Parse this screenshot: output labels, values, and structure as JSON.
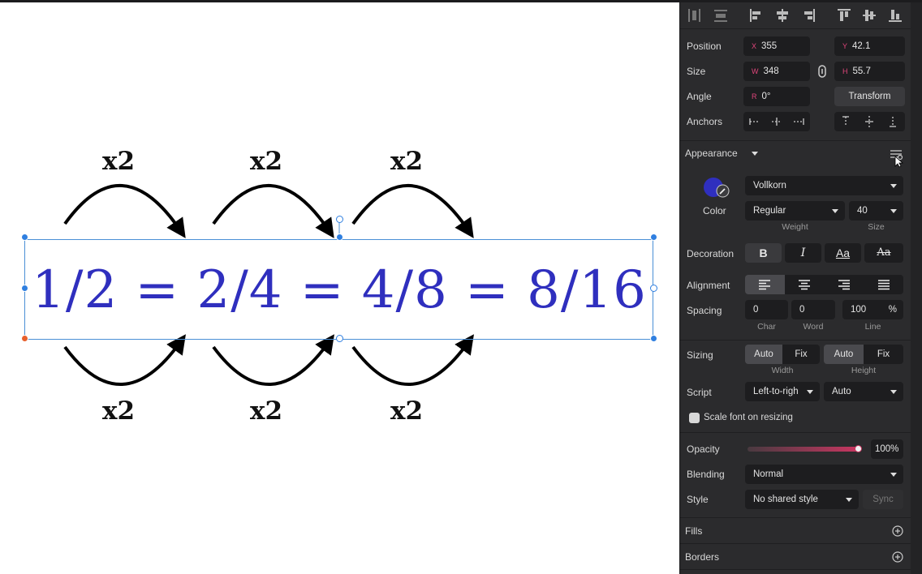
{
  "canvas": {
    "labels_top": [
      "x2",
      "x2",
      "x2"
    ],
    "labels_bottom": [
      "x2",
      "x2",
      "x2"
    ],
    "equation": "1/2 = 2/4 = 4/8 = 8/16"
  },
  "panel": {
    "position": {
      "label": "Position",
      "x_prefix": "X",
      "x_value": "355",
      "y_prefix": "Y",
      "y_value": "42.1"
    },
    "size": {
      "label": "Size",
      "w_prefix": "W",
      "w_value": "348",
      "h_prefix": "H",
      "h_value": "55.7"
    },
    "angle": {
      "label": "Angle",
      "r_prefix": "R",
      "r_value": "0°",
      "transform_label": "Transform"
    },
    "anchors": {
      "label": "Anchors"
    },
    "appearance": {
      "label": "Appearance"
    },
    "font": {
      "color_label": "Color",
      "color_value": "#2f2fbe",
      "family": "Vollkorn",
      "weight": "Regular",
      "weight_label": "Weight",
      "size": "40",
      "size_label": "Size"
    },
    "decoration": {
      "label": "Decoration",
      "bold": "B",
      "italic": "I",
      "case_aa": "Aa",
      "strike_aa": "Aa"
    },
    "alignment": {
      "label": "Alignment"
    },
    "spacing": {
      "label": "Spacing",
      "char": "0",
      "word": "0",
      "line": "100",
      "line_unit": "%",
      "char_label": "Char",
      "word_label": "Word",
      "line_label": "Line"
    },
    "sizing": {
      "label": "Sizing",
      "w_auto": "Auto",
      "w_fix": "Fix",
      "h_auto": "Auto",
      "h_fix": "Fix",
      "width_label": "Width",
      "height_label": "Height"
    },
    "script": {
      "label": "Script",
      "direction": "Left-to-righ",
      "mode": "Auto"
    },
    "scale_font": {
      "label": "Scale font on resizing",
      "checked": false
    },
    "opacity": {
      "label": "Opacity",
      "value": "100%",
      "fraction": 1.0
    },
    "blending": {
      "label": "Blending",
      "value": "Normal"
    },
    "style": {
      "label": "Style",
      "value": "No shared style",
      "sync": "Sync"
    },
    "fills": {
      "label": "Fills"
    },
    "borders": {
      "label": "Borders"
    }
  }
}
